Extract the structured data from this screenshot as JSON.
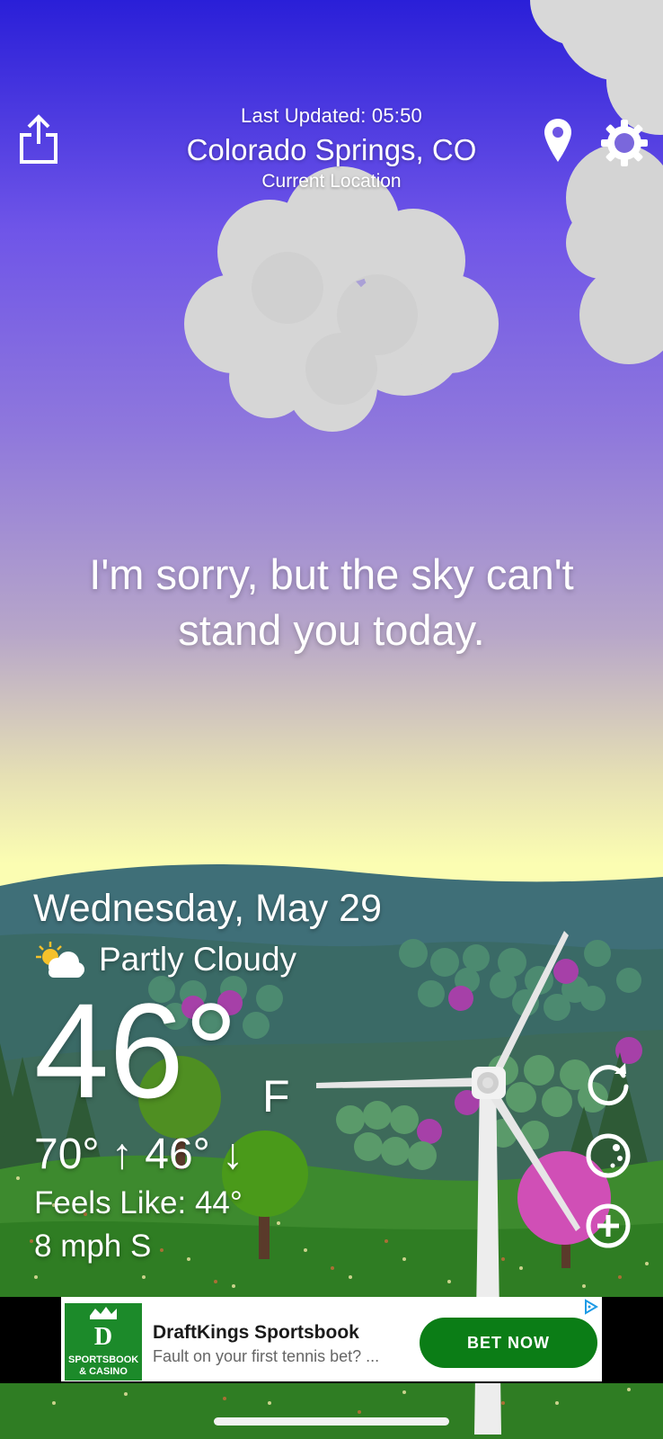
{
  "header": {
    "last_updated": "Last Updated: 05:50",
    "city": "Colorado Springs, CO",
    "location_label": "Current Location"
  },
  "message": "I'm sorry, but the sky can't stand you today.",
  "weather": {
    "date": "Wednesday, May 29",
    "condition": "Partly Cloudy",
    "condition_icon": "partly-cloudy-icon",
    "temperature": "46°",
    "unit": "F",
    "hi_lo": "70° ↑  46° ↓",
    "feels_like": "Feels Like: 44°",
    "wind": "8 mph S"
  },
  "icons": {
    "share": "share-icon",
    "location": "location-pin-icon",
    "settings": "gear-icon",
    "refresh": "refresh-icon",
    "moon": "moon-icon",
    "add": "plus-circle-icon"
  },
  "ad": {
    "logo_text": "SPORTSBOOK & CASINO",
    "title": "DraftKings Sportsbook",
    "subtitle": "Fault on your first tennis bet? ...",
    "cta": "BET NOW",
    "badge": "ad-choices-icon"
  },
  "colors": {
    "sky_top": "#2a1fd8",
    "sky_horizon": "#fbfdb2",
    "ad_green": "#0b7d16"
  }
}
